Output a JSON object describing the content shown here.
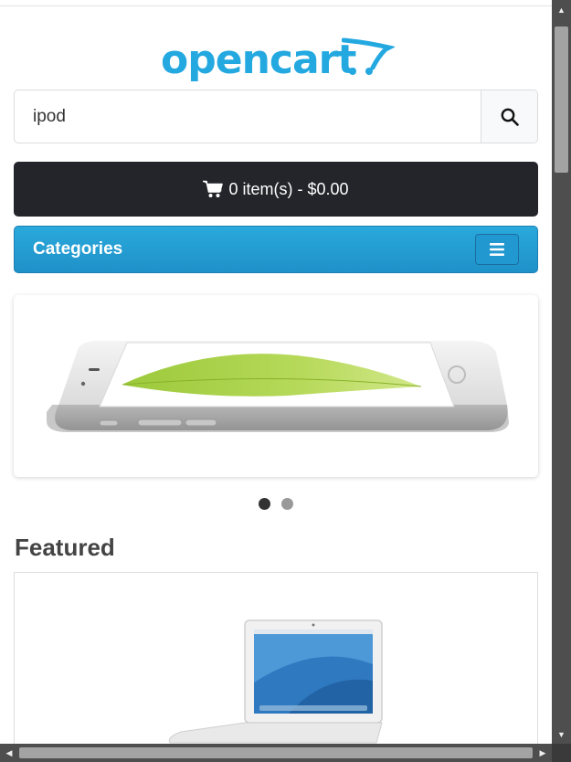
{
  "header": {
    "logo_text": "opencart"
  },
  "search": {
    "value": "ipod",
    "icon": "search-icon"
  },
  "cart": {
    "label": "0 item(s) - $0.00",
    "icon": "shopping-cart-icon"
  },
  "categories": {
    "label": "Categories",
    "toggle_icon": "hamburger-menu-icon"
  },
  "slideshow": {
    "image": "iPhone 6 product image",
    "dots": [
      {
        "state": "active"
      },
      {
        "state": "inactive"
      }
    ]
  },
  "featured": {
    "title": "Featured"
  },
  "colors": {
    "brand": "#23a8e0",
    "cart_bg": "#23252a",
    "categories_bg": "#229bd1"
  }
}
